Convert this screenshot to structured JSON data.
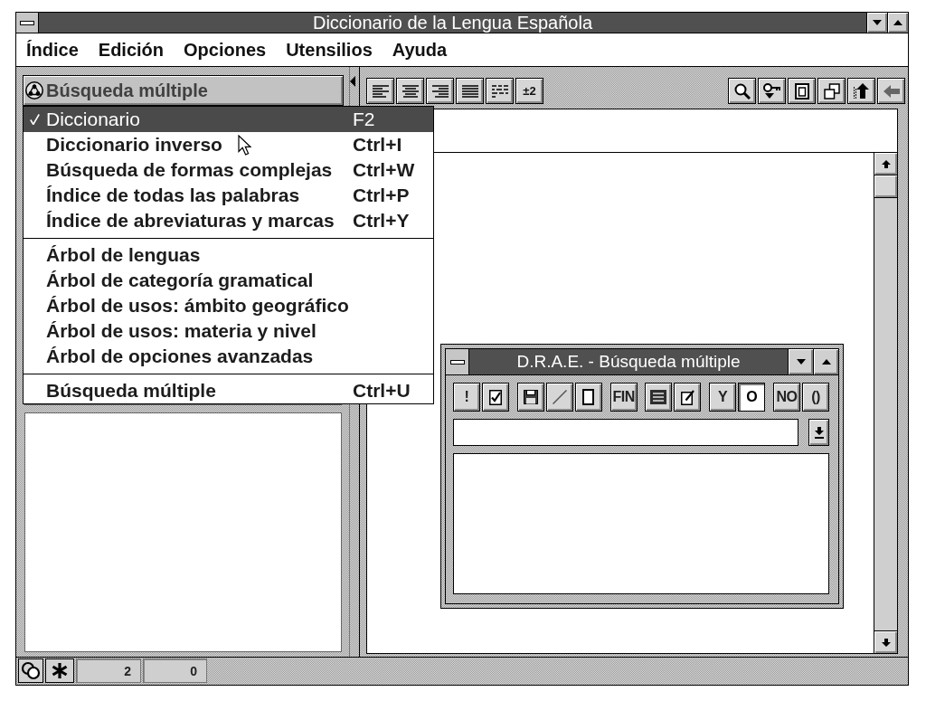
{
  "window": {
    "title": "Diccionario de la Lengua Española"
  },
  "menu_bar": [
    {
      "label": "Índice"
    },
    {
      "label": "Edición"
    },
    {
      "label": "Opciones"
    },
    {
      "label": "Utensilios"
    },
    {
      "label": "Ayuda"
    }
  ],
  "mode_button": {
    "label": "Búsqueda múltiple"
  },
  "mode_menu": [
    {
      "kind": "item",
      "label": "Diccionario",
      "shortcut": "F2",
      "checked": true,
      "selected": true
    },
    {
      "kind": "item",
      "label": "Diccionario inverso",
      "shortcut": "Ctrl+I",
      "checked": false,
      "selected": false
    },
    {
      "kind": "item",
      "label": "Búsqueda de formas complejas",
      "shortcut": "Ctrl+W",
      "checked": false,
      "selected": false
    },
    {
      "kind": "item",
      "label": "Índice de todas las palabras",
      "shortcut": "Ctrl+P",
      "checked": false,
      "selected": false
    },
    {
      "kind": "item",
      "label": "Índice de abreviaturas y marcas",
      "shortcut": "Ctrl+Y",
      "checked": false,
      "selected": false
    },
    {
      "kind": "separator"
    },
    {
      "kind": "item",
      "label": "Árbol de lenguas",
      "checked": false,
      "selected": false
    },
    {
      "kind": "item",
      "label": "Árbol de categoría gramatical",
      "checked": false,
      "selected": false
    },
    {
      "kind": "item",
      "label": "Árbol de usos: ámbito geográfico",
      "checked": false,
      "selected": false
    },
    {
      "kind": "item",
      "label": "Árbol de usos: materia y nivel",
      "checked": false,
      "selected": false
    },
    {
      "kind": "item",
      "label": "Árbol de opciones avanzadas",
      "checked": false,
      "selected": false
    },
    {
      "kind": "separator"
    },
    {
      "kind": "item",
      "label": "Búsqueda múltiple",
      "shortcut": "Ctrl+U",
      "checked": false,
      "selected": false
    }
  ],
  "format_toolbar": {
    "label_button": "±2"
  },
  "search_window": {
    "title": "D.R.A.E. - Búsqueda múltiple",
    "tool_groups": [
      [
        {
          "kind": "text",
          "label": "!",
          "pressed": false
        },
        {
          "kind": "check",
          "pressed": false
        }
      ],
      [
        {
          "kind": "save",
          "pressed": false
        },
        {
          "kind": "slash",
          "pressed": false
        },
        {
          "kind": "page",
          "pressed": false
        }
      ],
      [
        {
          "kind": "text",
          "label": "FIN",
          "pressed": false
        }
      ],
      [
        {
          "kind": "list",
          "pressed": false
        },
        {
          "kind": "edit",
          "pressed": false
        }
      ],
      [
        {
          "kind": "text",
          "label": "Y",
          "pressed": false
        },
        {
          "kind": "text",
          "label": "O",
          "pressed": true
        }
      ],
      [
        {
          "kind": "text",
          "label": "NO",
          "pressed": false
        },
        {
          "kind": "text",
          "label": "()",
          "pressed": false
        }
      ]
    ]
  },
  "status_bar": {
    "fields": [
      "2",
      "0"
    ]
  }
}
